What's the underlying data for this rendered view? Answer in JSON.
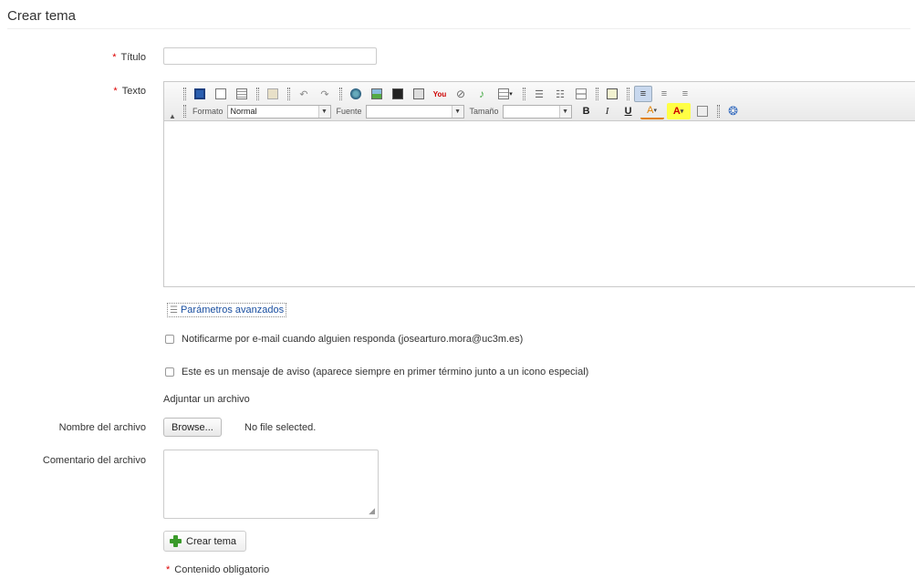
{
  "page_title": "Crear tema",
  "required_mark": "*",
  "fields": {
    "titulo_label": "Título",
    "texto_label": "Texto",
    "titulo_value": ""
  },
  "editor": {
    "formato_label": "Formato",
    "formato_value": "Normal",
    "fuente_label": "Fuente",
    "fuente_value": "",
    "tamano_label": "Tamaño",
    "tamano_value": "",
    "bold": "B",
    "italic": "I",
    "underline": "U",
    "text_color": "A",
    "bg_color": "A",
    "body_text": ""
  },
  "advanced": {
    "label": "Parámetros avanzados"
  },
  "options": {
    "notify_label": "Notificarme por e-mail cuando alguien responda (josearturo.mora@uc3m.es)",
    "notify_checked": false,
    "sticky_label": "Este es un mensaje de aviso (aparece siempre en primer término junto a un icono especial)",
    "sticky_checked": false
  },
  "attachment": {
    "section_label": "Adjuntar un archivo",
    "filename_label": "Nombre del archivo",
    "browse_label": "Browse...",
    "file_status": "No file selected.",
    "comment_label": "Comentario del archivo",
    "comment_value": ""
  },
  "submit_label": "Crear tema",
  "required_note": "Contenido obligatorio",
  "colors": {
    "required": "#dd0000",
    "link": "#1a4fa0",
    "plus_icon": "#3a9a2a"
  }
}
